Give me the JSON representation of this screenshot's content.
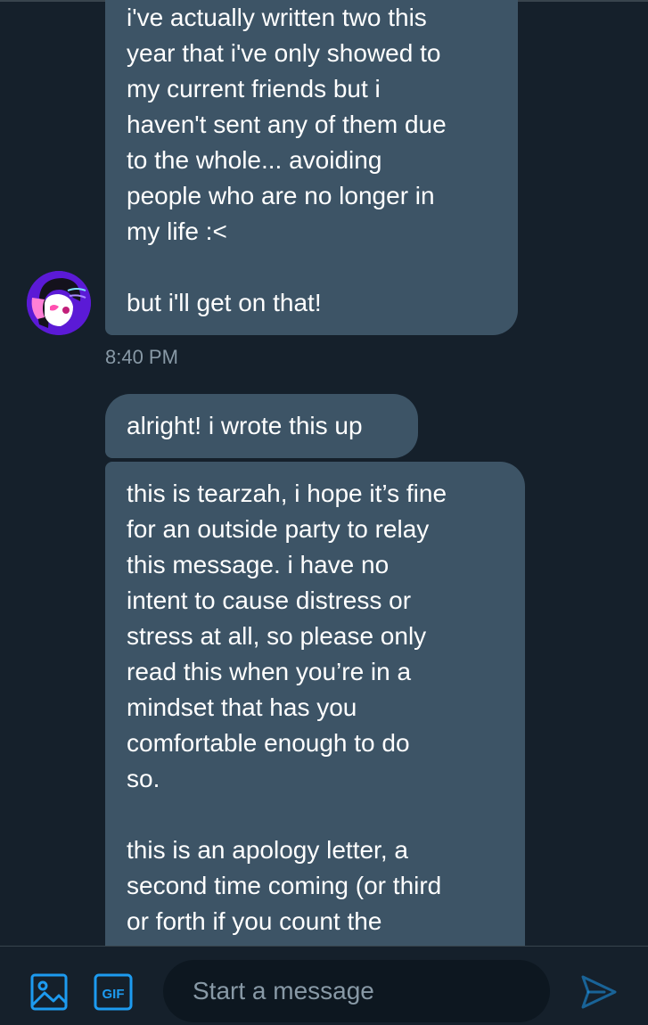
{
  "conversation": {
    "messages": [
      {
        "text": "i've actually written two this\nyear that i've only showed to\nmy current friends but i\nhaven't sent any of them due\nto the whole... avoiding\npeople who are no longer in\nmy life :<\n\nbut i'll get on that!"
      },
      {
        "text": "alright! i wrote this up"
      },
      {
        "text": "this is tearzah, i hope it’s fine\nfor an outside party to relay\nthis message. i have no\nintent to cause distress or\nstress at all, so please only\nread this when you’re in a\nmindset that has you\ncomfortable enough to do\nso.\n\nthis is an apology letter, a\nsecond time coming (or third\nor forth if you count the"
      }
    ],
    "timestamp": "8:40 PM"
  },
  "composer": {
    "placeholder": "Start a message",
    "gif_label": "GIF",
    "icons": [
      "image-icon",
      "gif-icon",
      "send-icon"
    ]
  },
  "colors": {
    "background": "#15202b",
    "bubble": "#3d5466",
    "accent": "#1d9bf0",
    "muted_text": "#8899a6",
    "input_background": "#0d1720"
  }
}
